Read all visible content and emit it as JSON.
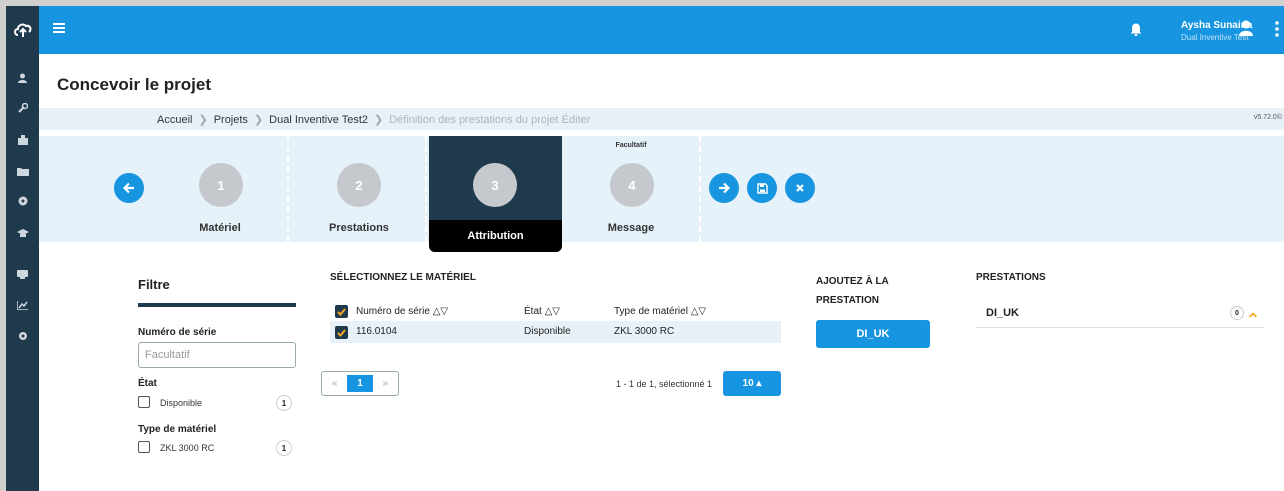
{
  "page": {
    "title": "Concevoir le projet",
    "version": "v5.72.0"
  },
  "topbar": {
    "user_name": "Aysha Sunaina",
    "user_company": "Dual Inventive Test"
  },
  "breadcrumb": [
    {
      "label": "Accueil",
      "active": true
    },
    {
      "label": "Projets",
      "active": true
    },
    {
      "label": "Dual Inventive Test2",
      "active": true
    },
    {
      "label": "Définition des prestations du projet Éditer",
      "active": false
    }
  ],
  "wizard": {
    "steps": [
      {
        "number": "1",
        "label": "Matériel",
        "optional_label": ""
      },
      {
        "number": "2",
        "label": "Prestations",
        "optional_label": ""
      },
      {
        "number": "3",
        "label": "Attribution",
        "optional_label": ""
      },
      {
        "number": "4",
        "label": "Message",
        "optional_label": "Facultatif"
      }
    ],
    "active_step": 3
  },
  "filter": {
    "title": "Filtre",
    "serial_label": "Numéro de série",
    "serial_placeholder": "Facultatif",
    "state_label": "État",
    "state_options": [
      {
        "label": "Disponible",
        "count": "1"
      }
    ],
    "type_label": "Type de matériel",
    "type_options": [
      {
        "label": "ZKL 3000 RC",
        "count": "1"
      }
    ]
  },
  "material": {
    "title": "SÉLECTIONNEZ LE MATÉRIEL",
    "columns": [
      "Numéro de série △▽",
      "État △▽",
      "Type de matériel △▽"
    ],
    "rows": [
      {
        "serial": "116.0104",
        "state": "Disponible",
        "type": "ZKL 3000 RC"
      }
    ],
    "pager": {
      "prev": "«",
      "current": "1",
      "next": "»"
    },
    "page_info": "1 - 1 de 1, sélectionné 1",
    "page_size": "10 ▴"
  },
  "add": {
    "title": "AJOUTEZ À LA PRESTATION",
    "button": "DI_UK"
  },
  "prestations": {
    "title": "PRESTATIONS",
    "items": [
      {
        "name": "DI_UK",
        "count": "0"
      }
    ]
  },
  "colors": {
    "primary": "#1795e0",
    "dark": "#1f3a4d"
  }
}
